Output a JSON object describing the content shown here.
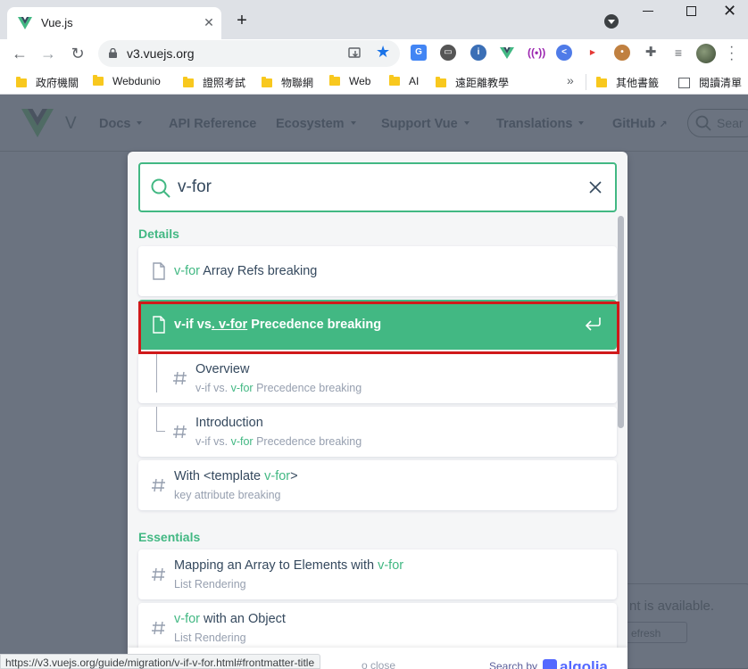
{
  "browser": {
    "tab_title": "Vue.js",
    "tab_close": "✕",
    "new_tab": "+",
    "url": "v3.vuejs.org",
    "bookmarks": [
      {
        "label": "政府機關"
      },
      {
        "label": "Webdunio"
      },
      {
        "label": "證照考試"
      },
      {
        "label": "物聯網"
      },
      {
        "label": "Web"
      },
      {
        "label": "AI"
      },
      {
        "label": "遠距離教學"
      }
    ],
    "bookmarks_more": "»",
    "other_bookmarks": "其他書籤",
    "reading_list": "閱讀清單",
    "status_url": "https://v3.vuejs.org/guide/migration/v-if-v-for.html#frontmatter-title"
  },
  "site": {
    "name": "V",
    "nav": [
      "Docs",
      "API Reference",
      "Ecosystem",
      "Support Vue",
      "Translations",
      "GitHub"
    ],
    "search_placeholder": "Sear",
    "update_text": "nt is available.",
    "refresh_label": "efresh"
  },
  "search": {
    "query": "v-for",
    "sections": [
      {
        "title": "Details",
        "hits": [
          {
            "pre": "",
            "hl": "v-for",
            "post": " Array Refs breaking",
            "path": ""
          },
          {
            "pre": "v-if vs",
            "hl": ". v-for",
            "post": " Precedence breaking",
            "path": "",
            "active": true
          },
          {
            "pre": "Overview",
            "hl": "",
            "post": "",
            "path_pre": "v-if vs. ",
            "path_hl": "v-for",
            "path_post": " Precedence breaking"
          },
          {
            "pre": "Introduction",
            "hl": "",
            "post": "",
            "path_pre": "v-if vs. ",
            "path_hl": "v-for",
            "path_post": " Precedence breaking"
          },
          {
            "pre": "With <template ",
            "hl": "v-for",
            "post": ">",
            "path": "key attribute breaking"
          }
        ]
      },
      {
        "title": "Essentials",
        "hits": [
          {
            "pre": "Mapping an Array to Elements with ",
            "hl": "v-for",
            "post": "",
            "path": "List Rendering"
          },
          {
            "pre": "",
            "hl": "v-for",
            "post": " with an Object",
            "path": "List Rendering"
          }
        ]
      }
    ],
    "footer_left": "o close",
    "footer_search_by": "Search by",
    "footer_brand": "algolia"
  },
  "colors": {
    "accent": "#42b883",
    "highlight_outline": "#d0191a",
    "overlay": "#6b7380"
  }
}
